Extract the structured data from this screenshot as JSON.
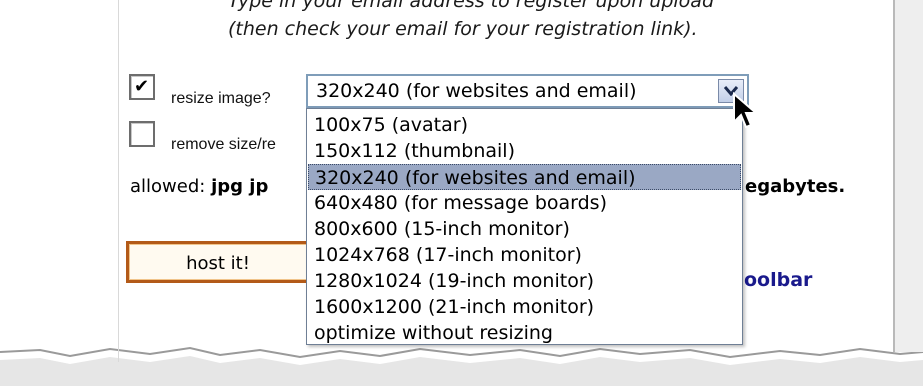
{
  "instructions": {
    "line1": "Type in your email address to register upon upload",
    "line2": "(then check your email for your registration link)."
  },
  "resize": {
    "checked": true,
    "label": "resize image?",
    "selected_value": "320x240 (for websites and email)",
    "options": [
      "100x75 (avatar)",
      "150x112 (thumbnail)",
      "320x240 (for websites and email)",
      "640x480 (for message boards)",
      "800x600 (15-inch monitor)",
      "1024x768 (17-inch monitor)",
      "1280x1024 (19-inch monitor)",
      "1600x1200 (21-inch monitor)",
      "optimize without resizing"
    ],
    "highlighted_index": 2
  },
  "remove": {
    "checked": false,
    "label": "remove size/re"
  },
  "allowed": {
    "label": "allowed:",
    "types": "jpg jp",
    "size_unit_fragment": "egabytes."
  },
  "host_button": {
    "label": "host it!"
  },
  "toolbar_link": {
    "text": "oolbar"
  },
  "colors": {
    "select_border": "#7f9db9",
    "highlight": "#9aa8c4",
    "button_border": "#b35a18",
    "link": "#1a1a8c"
  }
}
